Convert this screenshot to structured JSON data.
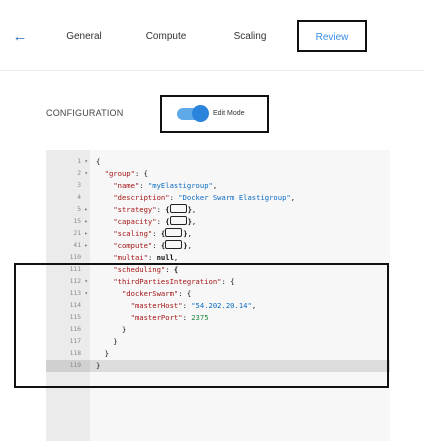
{
  "nav": {
    "back_icon": "arrow-left-icon",
    "tabs": [
      "General",
      "Compute",
      "Scaling",
      "Review"
    ],
    "active_tab": "Review",
    "accent_color": "#3a8fe3"
  },
  "config": {
    "label": "CONFIGURATION",
    "toggle_label": "Edit Mode",
    "toggle_on": true
  },
  "editor": {
    "lines": [
      {
        "num": "1",
        "fold": "▾",
        "code": [
          [
            "p",
            "{"
          ]
        ]
      },
      {
        "num": "2",
        "fold": "▾",
        "code": [
          [
            "p",
            "  "
          ],
          [
            "k",
            "\"group\""
          ],
          [
            "p",
            ": {"
          ]
        ]
      },
      {
        "num": "3",
        "fold": "",
        "code": [
          [
            "p",
            "    "
          ],
          [
            "k",
            "\"name\""
          ],
          [
            "p",
            ": "
          ],
          [
            "s",
            "\"myElastigroup\""
          ],
          [
            "p",
            ","
          ]
        ]
      },
      {
        "num": "4",
        "fold": "",
        "code": [
          [
            "p",
            "    "
          ],
          [
            "k",
            "\"description\""
          ],
          [
            "p",
            ": "
          ],
          [
            "s",
            "\"Docker Swarm Elastigroup\""
          ],
          [
            "p",
            ","
          ]
        ]
      },
      {
        "num": "5",
        "fold": "▸",
        "code": [
          [
            "p",
            "    "
          ],
          [
            "k",
            "\"strategy\""
          ],
          [
            "p",
            ": "
          ],
          [
            "pb",
            "{"
          ],
          [
            "box",
            ""
          ],
          [
            "pb",
            "}"
          ],
          [
            "p",
            ","
          ]
        ]
      },
      {
        "num": "15",
        "fold": "▸",
        "code": [
          [
            "p",
            "    "
          ],
          [
            "k",
            "\"capacity\""
          ],
          [
            "p",
            ": "
          ],
          [
            "pb",
            "{"
          ],
          [
            "box",
            ""
          ],
          [
            "pb",
            "}"
          ],
          [
            "p",
            ","
          ]
        ]
      },
      {
        "num": "21",
        "fold": "▸",
        "code": [
          [
            "p",
            "    "
          ],
          [
            "k",
            "\"scaling\""
          ],
          [
            "p",
            ": "
          ],
          [
            "pb",
            "{"
          ],
          [
            "box",
            ""
          ],
          [
            "pb",
            "}"
          ],
          [
            "p",
            ","
          ]
        ]
      },
      {
        "num": "41",
        "fold": "▸",
        "code": [
          [
            "p",
            "    "
          ],
          [
            "k",
            "\"compute\""
          ],
          [
            "p",
            ": "
          ],
          [
            "pb",
            "{"
          ],
          [
            "box",
            ""
          ],
          [
            "pb",
            "}"
          ],
          [
            "p",
            ","
          ]
        ]
      },
      {
        "num": "110",
        "fold": "",
        "code": [
          [
            "p",
            "    "
          ],
          [
            "k",
            "\"multai\""
          ],
          [
            "p",
            ": "
          ],
          [
            "lit",
            "null"
          ],
          [
            "p",
            ","
          ]
        ]
      },
      {
        "num": "111",
        "fold": "",
        "code": [
          [
            "p",
            "    "
          ],
          [
            "k",
            "\"scheduling\""
          ],
          [
            "p",
            ": "
          ],
          [
            "pb",
            "{"
          ]
        ]
      },
      {
        "num": "112",
        "fold": "▾",
        "code": [
          [
            "p",
            "    "
          ],
          [
            "k",
            "\"thirdPartiesIntegration\""
          ],
          [
            "p",
            ": {"
          ]
        ]
      },
      {
        "num": "113",
        "fold": "▾",
        "code": [
          [
            "p",
            "      "
          ],
          [
            "k",
            "\"dockerSwarm\""
          ],
          [
            "p",
            ": {"
          ]
        ]
      },
      {
        "num": "114",
        "fold": "",
        "code": [
          [
            "p",
            "        "
          ],
          [
            "k",
            "\"masterHost\""
          ],
          [
            "p",
            ": "
          ],
          [
            "s",
            "\"54.202.20.14\""
          ],
          [
            "p",
            ","
          ]
        ]
      },
      {
        "num": "115",
        "fold": "",
        "code": [
          [
            "p",
            "        "
          ],
          [
            "k",
            "\"masterPort\""
          ],
          [
            "p",
            ": "
          ],
          [
            "n",
            "2375"
          ]
        ]
      },
      {
        "num": "116",
        "fold": "",
        "code": [
          [
            "p",
            "      }"
          ]
        ]
      },
      {
        "num": "117",
        "fold": "",
        "code": [
          [
            "p",
            "    }"
          ]
        ]
      },
      {
        "num": "118",
        "fold": "",
        "code": [
          [
            "p",
            "  }"
          ]
        ]
      },
      {
        "num": "119",
        "fold": "",
        "code": [
          [
            "p",
            "}"
          ]
        ],
        "active": true
      }
    ]
  }
}
